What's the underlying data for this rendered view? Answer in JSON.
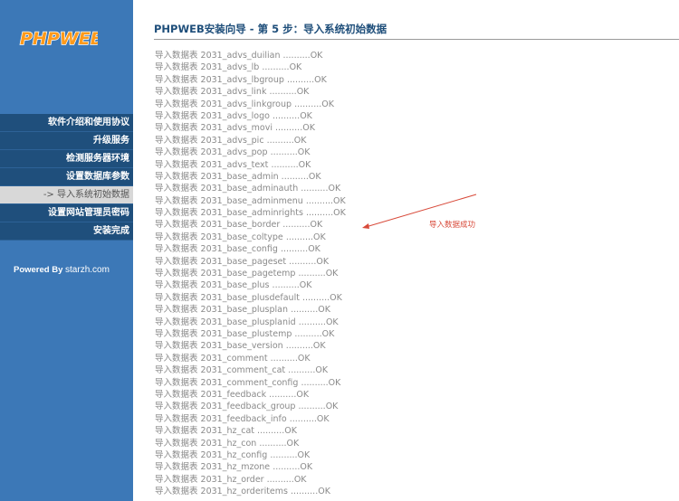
{
  "logo": {
    "text": "PHPWEB"
  },
  "nav": [
    {
      "label": "软件介绍和使用协议",
      "active": false
    },
    {
      "label": "升级服务",
      "active": false
    },
    {
      "label": "检测服务器环境",
      "active": false
    },
    {
      "label": "设置数据库参数",
      "active": false
    },
    {
      "label": "-> 导入系统初始数据",
      "active": true
    },
    {
      "label": "设置网站管理员密码",
      "active": false
    },
    {
      "label": "安装完成",
      "active": false
    }
  ],
  "powered": {
    "prefix": "Powered By ",
    "site": "starzh.com"
  },
  "title": "PHPWEB安装向导 - 第 5 步：导入系统初始数据",
  "log_prefix": "导入数据表",
  "log_status": "OK",
  "log": [
    "2031_advs_duilian",
    "2031_advs_lb",
    "2031_advs_lbgroup",
    "2031_advs_link",
    "2031_advs_linkgroup",
    "2031_advs_logo",
    "2031_advs_movi",
    "2031_advs_pic",
    "2031_advs_pop",
    "2031_advs_text",
    "2031_base_admin",
    "2031_base_adminauth",
    "2031_base_adminmenu",
    "2031_base_adminrights",
    "2031_base_border",
    "2031_base_coltype",
    "2031_base_config",
    "2031_base_pageset",
    "2031_base_pagetemp",
    "2031_base_plus",
    "2031_base_plusdefault",
    "2031_base_plusplan",
    "2031_base_plusplanid",
    "2031_base_plustemp",
    "2031_base_version",
    "2031_comment",
    "2031_comment_cat",
    "2031_comment_config",
    "2031_feedback",
    "2031_feedback_group",
    "2031_feedback_info",
    "2031_hz_cat",
    "2031_hz_con",
    "2031_hz_config",
    "2031_hz_mzone",
    "2031_hz_order",
    "2031_hz_orderitems"
  ],
  "annotation": {
    "text": "导入数据成功",
    "color": "#d84a3a"
  },
  "colors": {
    "sidebar": "#3c78b7",
    "nav": "#1f4f7c",
    "title": "#1e4e7a"
  }
}
